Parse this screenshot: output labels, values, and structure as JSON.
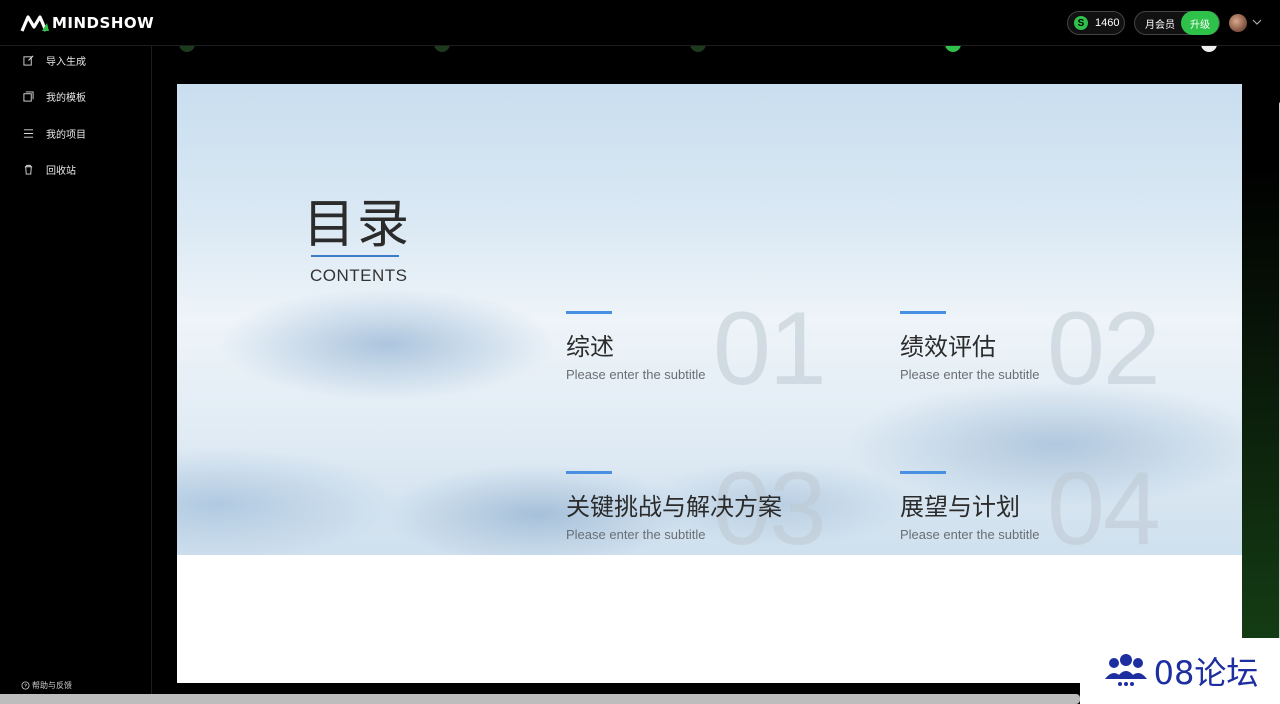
{
  "app": {
    "brand": "MINDSHOW"
  },
  "topbar": {
    "coins": "1460",
    "membership_label": "月会员",
    "upgrade_label": "升级"
  },
  "sidebar": {
    "items": [
      {
        "label": "导入生成",
        "icon": "edit-import-icon"
      },
      {
        "label": "我的模板",
        "icon": "template-icon"
      },
      {
        "label": "我的项目",
        "icon": "list-icon"
      },
      {
        "label": "回收站",
        "icon": "trash-icon"
      }
    ],
    "help_label": "帮助与反馈"
  },
  "slide": {
    "title": "目录",
    "title_en": "CONTENTS",
    "items": [
      {
        "num": "01",
        "heading": "综述",
        "subtitle": "Please enter the subtitle"
      },
      {
        "num": "02",
        "heading": "绩效评估",
        "subtitle": "Please enter the subtitle"
      },
      {
        "num": "03",
        "heading": "关键挑战与解决方案",
        "subtitle": "Please enter the subtitle"
      },
      {
        "num": "04",
        "heading": "展望与计划",
        "subtitle": "Please enter the subtitle"
      }
    ]
  },
  "watermark": {
    "text": "08论坛"
  },
  "colors": {
    "accent": "#2fc24a",
    "slide_accent": "#4a90e2",
    "watermark": "#1d2fa0"
  }
}
